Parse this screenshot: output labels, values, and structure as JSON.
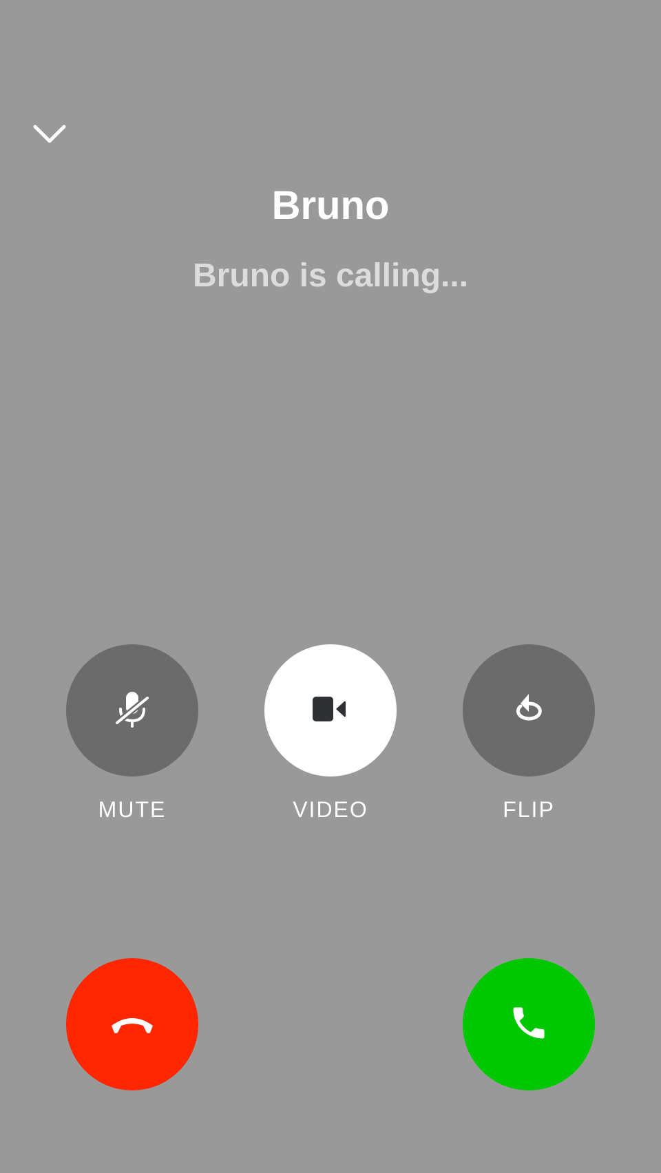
{
  "caller": {
    "name": "Bruno",
    "status": "Bruno is calling..."
  },
  "top_bar": {
    "collapse_icon": "chevron-down-icon"
  },
  "actions": [
    {
      "label": "MUTE",
      "icon": "mic-off-icon"
    },
    {
      "label": "VIDEO",
      "icon": "video-camera-icon"
    },
    {
      "label": "FLIP",
      "icon": "flip-camera-icon"
    }
  ],
  "call_controls": {
    "decline_icon": "phone-hangup-icon",
    "accept_icon": "phone-icon",
    "decline_color": "#ff2600",
    "accept_color": "#00c800"
  },
  "colors": {
    "background": "#999999",
    "action_button": "#6b6b6b",
    "video_button": "#ffffff",
    "icon_dark": "#2e3033"
  }
}
